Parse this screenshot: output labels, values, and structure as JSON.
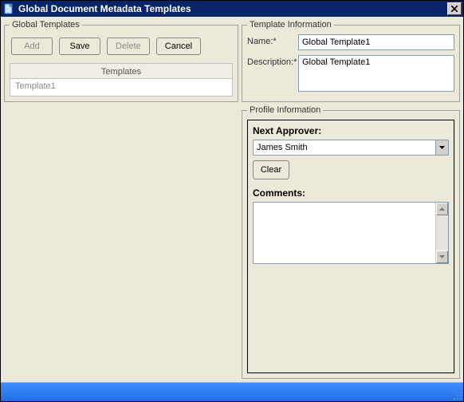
{
  "window": {
    "title": "Global Document Metadata Templates"
  },
  "global_templates": {
    "legend": "Global Templates",
    "buttons": {
      "add": "Add",
      "save": "Save",
      "delete": "Delete",
      "cancel": "Cancel"
    },
    "list_header": "Templates",
    "items": [
      "Template1"
    ]
  },
  "template_info": {
    "legend": "Template Information",
    "name_label": "Name:*",
    "name_value": "Global Template1",
    "desc_label": "Description:*",
    "desc_value": "Global Template1"
  },
  "profile": {
    "legend": "Profile Information",
    "next_approver_label": "Next Approver:",
    "next_approver_value": "James Smith",
    "clear_label": "Clear",
    "comments_label": "Comments:",
    "comments_value": ""
  }
}
